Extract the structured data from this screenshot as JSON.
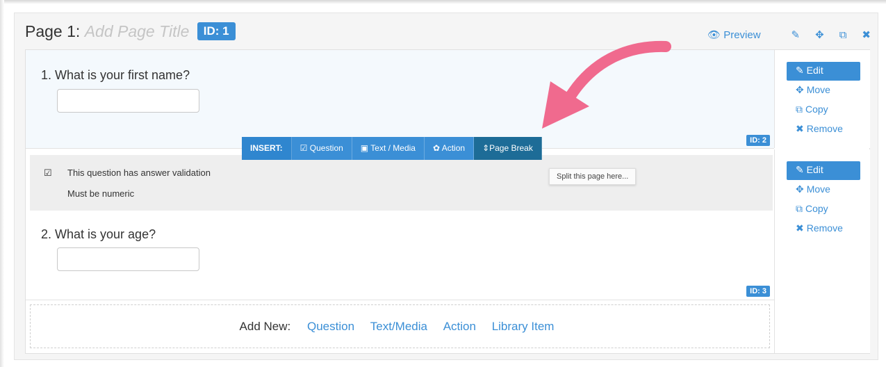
{
  "page": {
    "title_prefix": "Page 1:",
    "title_placeholder": "Add Page Title",
    "id_badge": "ID: 1",
    "tools": {
      "preview_label": "Preview",
      "preview_icon": "eye-icon",
      "edit_icon": "pencil-icon",
      "move_icon": "move-arrows-icon",
      "copy_icon": "copy-icon",
      "delete_icon": "close-icon"
    }
  },
  "questions": [
    {
      "label": "1. What is your first name?",
      "id_badge": "ID: 2"
    },
    {
      "label": "2. What is your age?",
      "id_badge": "ID: 3",
      "validation": {
        "line1": "This question has answer validation",
        "line2": "Must be numeric"
      }
    }
  ],
  "actions": {
    "edit": "Edit",
    "move": "Move",
    "copy": "Copy",
    "remove": "Remove"
  },
  "insert_bar": {
    "label": "INSERT:",
    "question": "Question",
    "text_media": "Text / Media",
    "action": "Action",
    "page_break": "Page Break"
  },
  "tooltip": "Split this page here...",
  "add_new": {
    "label": "Add New:",
    "question": "Question",
    "text_media": "Text/Media",
    "action": "Action",
    "library_item": "Library Item"
  },
  "colors": {
    "accent": "#3b8fd6",
    "insert_active": "#1d6c97",
    "arrow": "#f06a8e",
    "question_bg": "#f4f9fd"
  }
}
